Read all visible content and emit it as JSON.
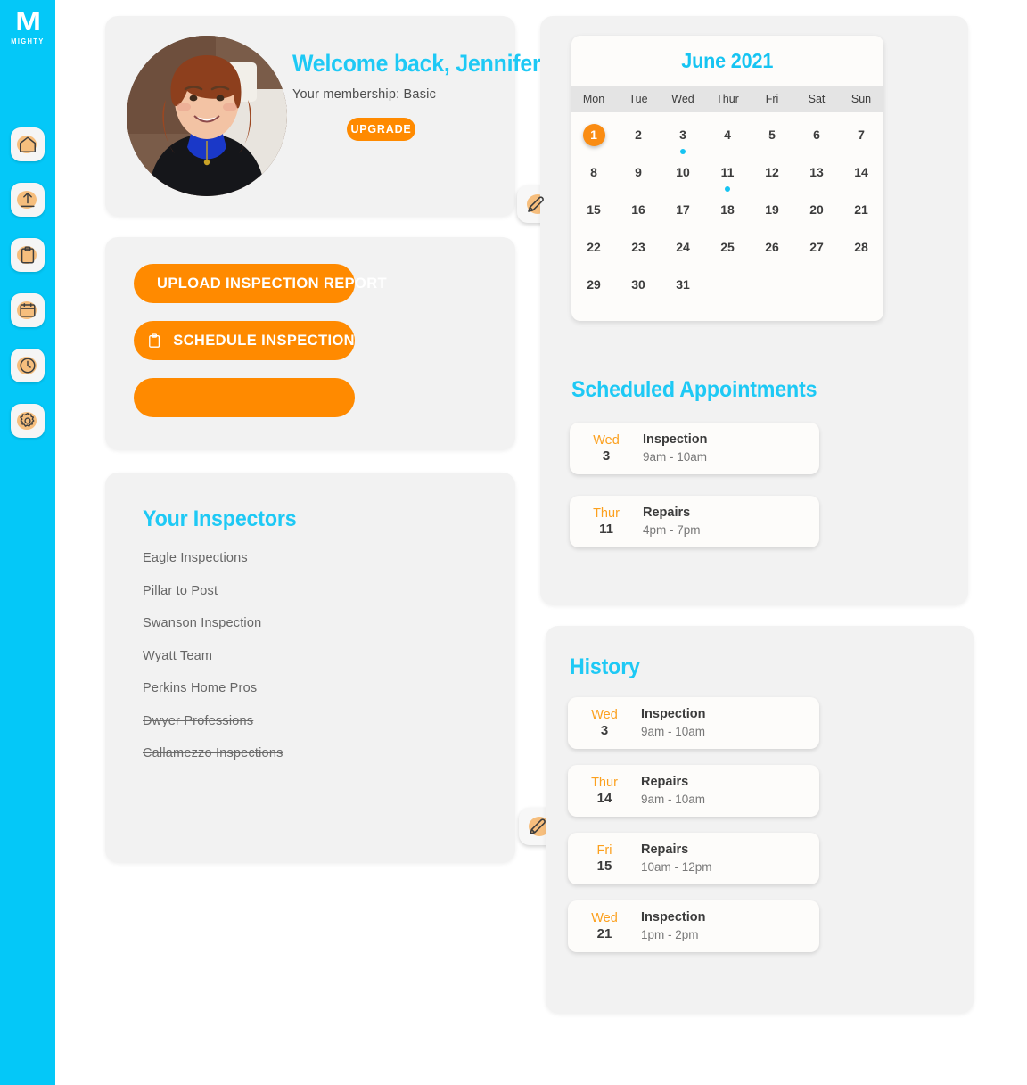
{
  "brand": {
    "logo_letter": "M",
    "logo_word": "MIGHTY",
    "accent_cyan": "#04C8F8",
    "accent_orange": "#FF8A00"
  },
  "sidebar": {
    "items": [
      {
        "name": "home-icon",
        "label": "Home"
      },
      {
        "name": "upload-icon",
        "label": "Upload"
      },
      {
        "name": "clipboard-icon",
        "label": "Reports"
      },
      {
        "name": "calendar-icon",
        "label": "Calendar"
      },
      {
        "name": "clock-icon",
        "label": "History"
      },
      {
        "name": "gear-icon",
        "label": "Settings"
      }
    ]
  },
  "profile": {
    "welcome": "Welcome back, Jennifer",
    "membership": "Your membership: Basic",
    "upgrade_label": "UPGRADE",
    "edit_icon": "pencil-icon"
  },
  "actions": {
    "upload_label": "UPLOAD INSPECTION REPORT",
    "upload_icon": "upload-arrow-icon",
    "schedule_label": "SCHEDULE INSPECTION",
    "schedule_icon": "clipboard-icon",
    "empty_label": ""
  },
  "inspectors": {
    "title": "Your Inspectors",
    "edit_icon": "pencil-icon",
    "items": [
      {
        "name": "Eagle Inspections",
        "struck": false
      },
      {
        "name": "Pillar to Post",
        "struck": false
      },
      {
        "name": "Swanson Inspection",
        "struck": false
      },
      {
        "name": "Wyatt Team",
        "struck": false
      },
      {
        "name": "Perkins Home Pros",
        "struck": false
      },
      {
        "name": "Dwyer Professions",
        "struck": true
      },
      {
        "name": "Callamezzo Inspections",
        "struck": true
      }
    ]
  },
  "calendar": {
    "month_label": "June 2021",
    "weekdays": [
      "Mon",
      "Tue",
      "Wed",
      "Thur",
      "Fri",
      "Sat",
      "Sun"
    ],
    "days": [
      {
        "n": "1",
        "today": true,
        "dot": false
      },
      {
        "n": "2",
        "today": false,
        "dot": false
      },
      {
        "n": "3",
        "today": false,
        "dot": true
      },
      {
        "n": "4",
        "today": false,
        "dot": false
      },
      {
        "n": "5",
        "today": false,
        "dot": false
      },
      {
        "n": "6",
        "today": false,
        "dot": false
      },
      {
        "n": "7",
        "today": false,
        "dot": false
      },
      {
        "n": "8",
        "today": false,
        "dot": false
      },
      {
        "n": "9",
        "today": false,
        "dot": false
      },
      {
        "n": "10",
        "today": false,
        "dot": false
      },
      {
        "n": "11",
        "today": false,
        "dot": true
      },
      {
        "n": "12",
        "today": false,
        "dot": false
      },
      {
        "n": "13",
        "today": false,
        "dot": false
      },
      {
        "n": "14",
        "today": false,
        "dot": false
      },
      {
        "n": "15",
        "today": false,
        "dot": false
      },
      {
        "n": "16",
        "today": false,
        "dot": false
      },
      {
        "n": "17",
        "today": false,
        "dot": false
      },
      {
        "n": "18",
        "today": false,
        "dot": false
      },
      {
        "n": "19",
        "today": false,
        "dot": false
      },
      {
        "n": "20",
        "today": false,
        "dot": false
      },
      {
        "n": "21",
        "today": false,
        "dot": false
      },
      {
        "n": "22",
        "today": false,
        "dot": false
      },
      {
        "n": "23",
        "today": false,
        "dot": false
      },
      {
        "n": "24",
        "today": false,
        "dot": false
      },
      {
        "n": "25",
        "today": false,
        "dot": false
      },
      {
        "n": "26",
        "today": false,
        "dot": false
      },
      {
        "n": "27",
        "today": false,
        "dot": false
      },
      {
        "n": "28",
        "today": false,
        "dot": false
      },
      {
        "n": "29",
        "today": false,
        "dot": false
      },
      {
        "n": "30",
        "today": false,
        "dot": false
      },
      {
        "n": "31",
        "today": false,
        "dot": false
      }
    ]
  },
  "appointments": {
    "title": "Scheduled Appointments",
    "items": [
      {
        "dow": "Wed",
        "day": "3",
        "name": "Inspection",
        "time": "9am - 10am"
      },
      {
        "dow": "Thur",
        "day": "11",
        "name": "Repairs",
        "time": "4pm - 7pm"
      }
    ],
    "action_icons": [
      "briefcase-icon",
      "clipboard-icon"
    ]
  },
  "history": {
    "title": "History",
    "items": [
      {
        "dow": "Wed",
        "day": "3",
        "name": "Inspection",
        "time": "9am - 10am"
      },
      {
        "dow": "Thur",
        "day": "14",
        "name": "Repairs",
        "time": "9am - 10am"
      },
      {
        "dow": "Fri",
        "day": "15",
        "name": "Repairs",
        "time": "10am - 12pm"
      },
      {
        "dow": "Wed",
        "day": "21",
        "name": "Inspection",
        "time": "1pm - 2pm"
      }
    ]
  }
}
